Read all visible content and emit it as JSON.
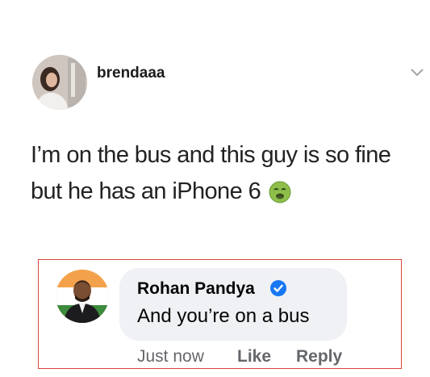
{
  "tweet": {
    "username": "brendaaa",
    "text": "I’m on the bus and this guy is so fine but he has an iPhone 6",
    "emoji": "nauseated-face-emoji",
    "menu_icon": "chevron-down-icon"
  },
  "reply": {
    "name": "Rohan Pandya",
    "verified_icon": "verified-badge-icon",
    "text": "And you’re on a bus",
    "timestamp": "Just now",
    "like_label": "Like",
    "reply_label": "Reply"
  },
  "colors": {
    "highlight_border": "#d6463a",
    "bubble_bg": "#eff1f4",
    "verified_blue": "#1877f2"
  }
}
